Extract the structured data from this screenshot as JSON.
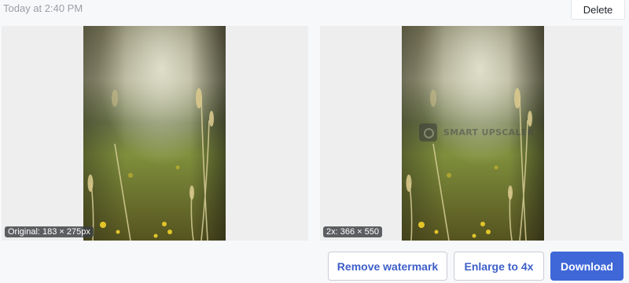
{
  "header": {
    "timestamp": "Today at 2:40 PM",
    "delete_label": "Delete"
  },
  "original": {
    "badge": "Original: 183 × 275px"
  },
  "upscaled": {
    "badge": "2x: 366 × 550",
    "watermark_text": "SMART UPSCALER"
  },
  "actions": {
    "remove_watermark": "Remove watermark",
    "enlarge": "Enlarge to 4x",
    "download": "Download"
  },
  "colors": {
    "primary": "#3f67d8",
    "outline_text": "#3e5fc9"
  }
}
